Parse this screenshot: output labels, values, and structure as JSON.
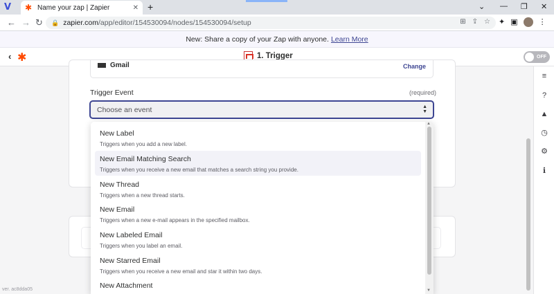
{
  "browser": {
    "tab_title": "Name your zap | Zapier",
    "url_host": "zapier.com",
    "url_path": "/app/editor/154530094/nodes/154530094/setup"
  },
  "banner": {
    "text": "New: Share a copy of your Zap with anyone.",
    "link": "Learn More"
  },
  "header": {
    "step_title": "1. Trigger",
    "toggle_label": "OFF"
  },
  "app_row": {
    "app_name": "Gmail",
    "change_label": "Change"
  },
  "trigger_field": {
    "label": "Trigger Event",
    "required": "(required)",
    "placeholder": "Choose an event"
  },
  "events": [
    {
      "title": "New Label",
      "desc": "Triggers when you add a new label."
    },
    {
      "title": "New Email Matching Search",
      "desc": "Triggers when you receive a new email that matches a search string you provide."
    },
    {
      "title": "New Thread",
      "desc": "Triggers when a new thread starts."
    },
    {
      "title": "New Email",
      "desc": "Triggers when a new e-mail appears in the specified mailbox."
    },
    {
      "title": "New Labeled Email",
      "desc": "Triggers when you label an email."
    },
    {
      "title": "New Starred Email",
      "desc": "Triggers when you receive a new email and star it within two days."
    },
    {
      "title": "New Attachment",
      "desc": ""
    }
  ],
  "version": "ver. ac8dda05",
  "colors": {
    "brand": "#ff4a00",
    "accent": "#3d4592"
  }
}
